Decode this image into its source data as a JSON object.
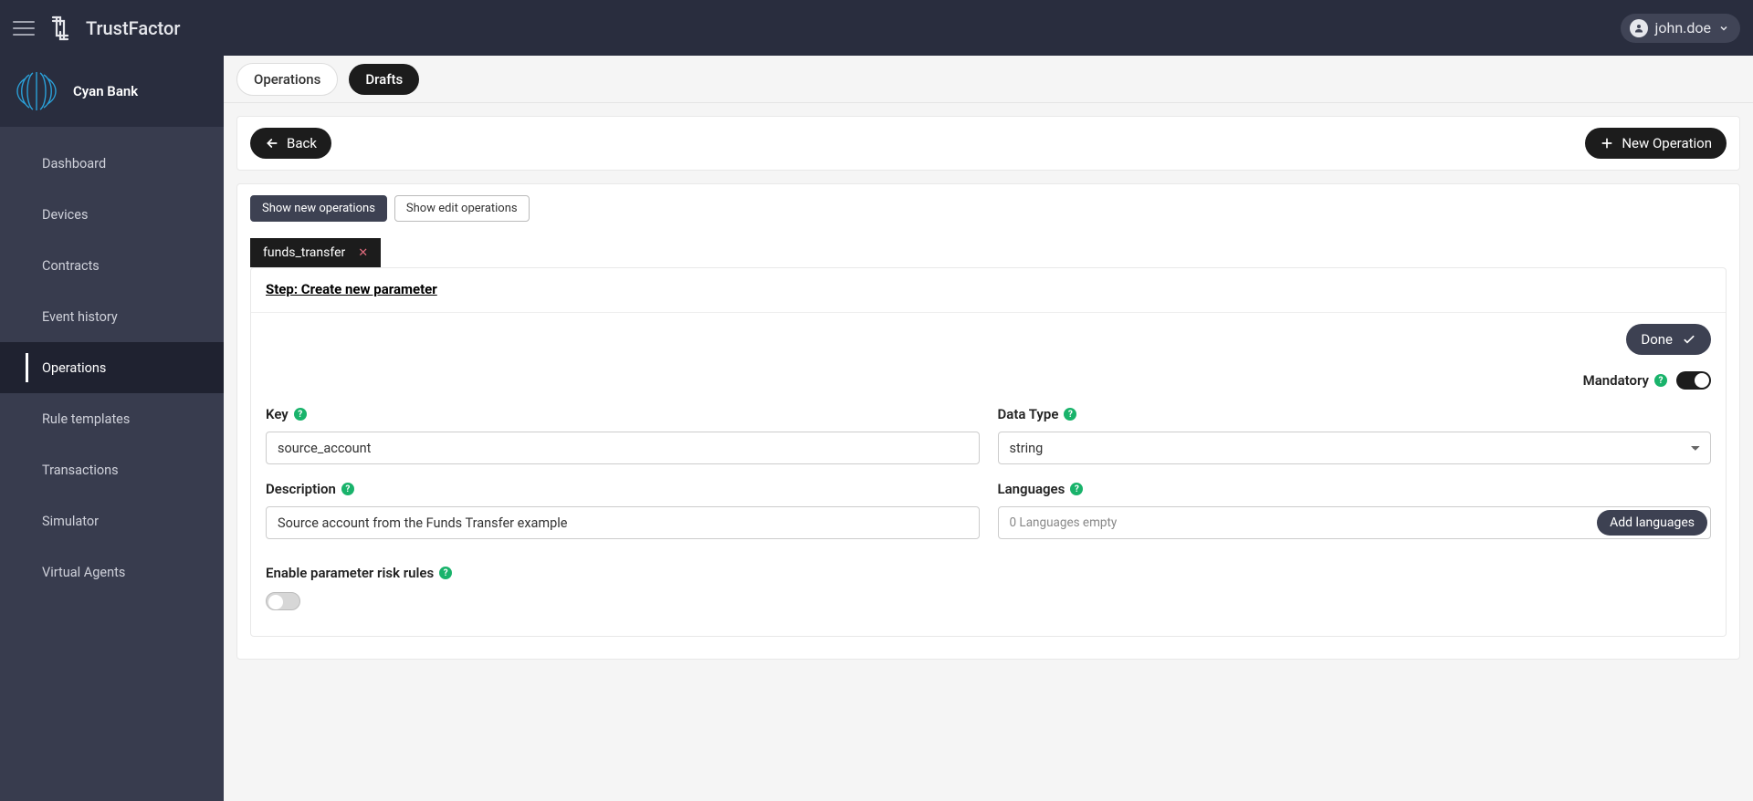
{
  "brand": {
    "name": "TrustFactor"
  },
  "user": {
    "name": "john.doe"
  },
  "tenant": {
    "name": "Cyan Bank"
  },
  "sidebar": {
    "items": [
      {
        "label": "Dashboard"
      },
      {
        "label": "Devices"
      },
      {
        "label": "Contracts"
      },
      {
        "label": "Event history"
      },
      {
        "label": "Operations"
      },
      {
        "label": "Rule templates"
      },
      {
        "label": "Transactions"
      },
      {
        "label": "Simulator"
      },
      {
        "label": "Virtual Agents"
      }
    ],
    "activeIndex": 4
  },
  "tabs": {
    "operations": "Operations",
    "drafts": "Drafts"
  },
  "actions": {
    "back": "Back",
    "newOperation": "New Operation"
  },
  "filters": {
    "showNew": "Show new operations",
    "showEdit": "Show edit operations"
  },
  "operationTab": {
    "name": "funds_transfer"
  },
  "step": {
    "title": "Step: Create new parameter",
    "done": "Done",
    "mandatoryLabel": "Mandatory",
    "mandatoryOn": true,
    "fields": {
      "keyLabel": "Key",
      "keyValue": "source_account",
      "dataTypeLabel": "Data Type",
      "dataTypeValue": "string",
      "descriptionLabel": "Description",
      "descriptionValue": "Source account from the Funds Transfer example",
      "languagesLabel": "Languages",
      "languagesStatus": "0 Languages empty",
      "addLanguages": "Add languages",
      "riskLabel": "Enable parameter risk rules",
      "riskOn": false
    }
  }
}
